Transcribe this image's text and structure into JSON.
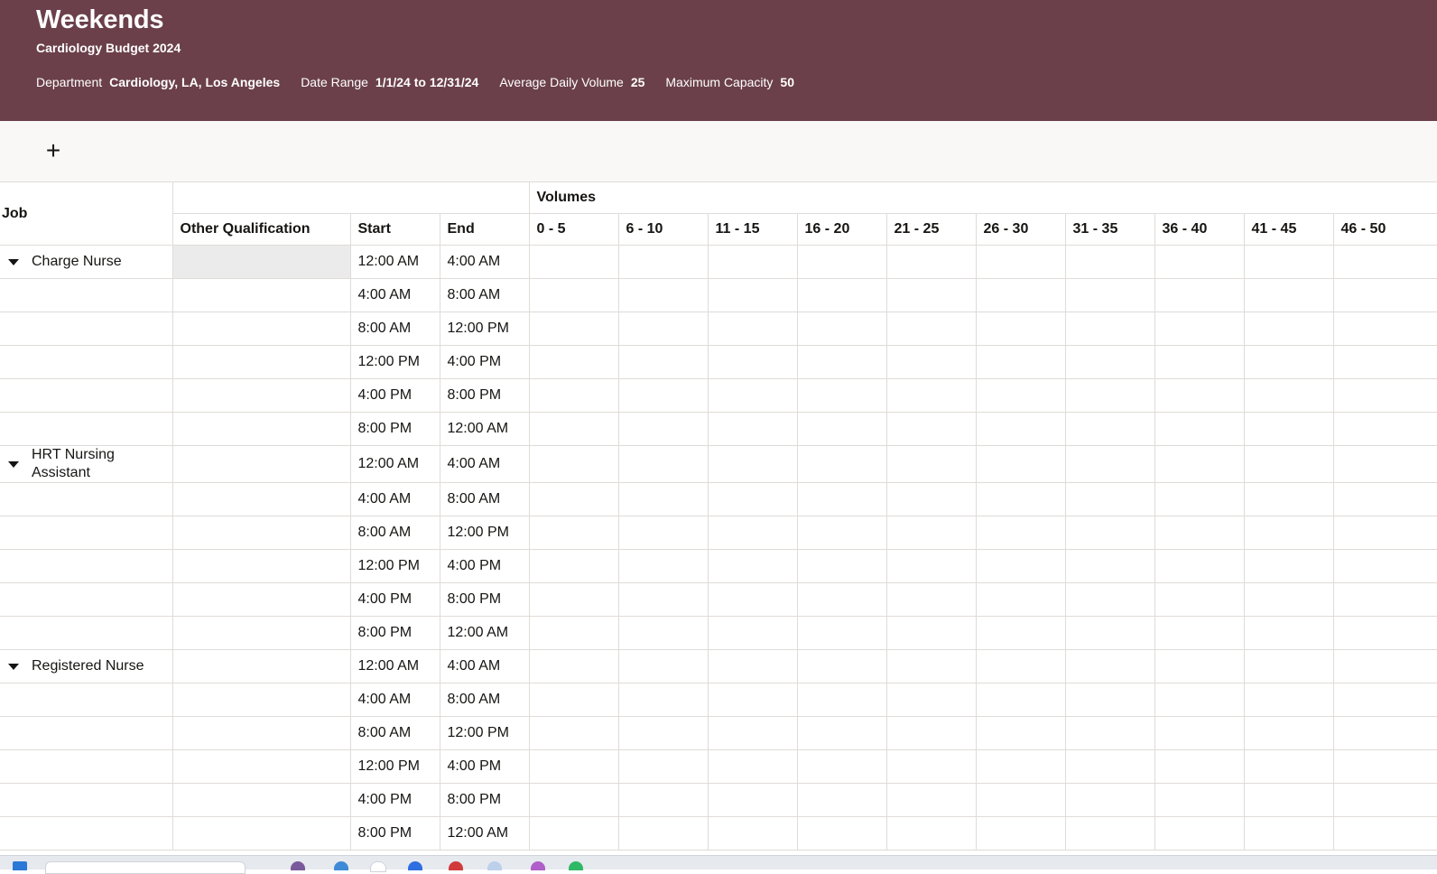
{
  "header": {
    "title": "Weekends",
    "subtitle": "Cardiology Budget 2024",
    "meta": [
      {
        "label": "Department",
        "value": "Cardiology, LA, Los Angeles"
      },
      {
        "label": "Date Range",
        "value": "1/1/24 to 12/31/24"
      },
      {
        "label": "Average Daily Volume",
        "value": "25"
      },
      {
        "label": "Maximum Capacity",
        "value": "50"
      }
    ],
    "background_color": "#6b404a"
  },
  "toolbar": {
    "add_icon": "plus-icon",
    "add_symbol": "+"
  },
  "grid": {
    "job_header": "Job",
    "volumes_header": "Volumes",
    "columns": [
      "Other Qualification",
      "Start",
      "End"
    ],
    "volume_ranges": [
      "0 - 5",
      "6 - 10",
      "11 - 15",
      "16 - 20",
      "21 - 25",
      "26 - 30",
      "31 - 35",
      "36 - 40",
      "41 - 45",
      "46 - 50"
    ],
    "rows": [
      {
        "job": "Charge Nurse",
        "start": "12:00 AM",
        "end": "4:00 AM"
      },
      {
        "job": "",
        "start": "4:00 AM",
        "end": "8:00 AM"
      },
      {
        "job": "",
        "start": "8:00 AM",
        "end": "12:00 PM"
      },
      {
        "job": "",
        "start": "12:00 PM",
        "end": "4:00 PM"
      },
      {
        "job": "",
        "start": "4:00 PM",
        "end": "8:00 PM"
      },
      {
        "job": "",
        "start": "8:00 PM",
        "end": "12:00 AM"
      },
      {
        "job": "HRT Nursing Assistant",
        "start": "12:00 AM",
        "end": "4:00 AM"
      },
      {
        "job": "",
        "start": "4:00 AM",
        "end": "8:00 AM"
      },
      {
        "job": "",
        "start": "8:00 AM",
        "end": "12:00 PM"
      },
      {
        "job": "",
        "start": "12:00 PM",
        "end": "4:00 PM"
      },
      {
        "job": "",
        "start": "4:00 PM",
        "end": "8:00 PM"
      },
      {
        "job": "",
        "start": "8:00 PM",
        "end": "12:00 AM"
      },
      {
        "job": "Registered Nurse",
        "start": "12:00 AM",
        "end": "4:00 AM"
      },
      {
        "job": "",
        "start": "4:00 AM",
        "end": "8:00 AM"
      },
      {
        "job": "",
        "start": "8:00 AM",
        "end": "12:00 PM"
      },
      {
        "job": "",
        "start": "12:00 PM",
        "end": "4:00 PM"
      },
      {
        "job": "",
        "start": "4:00 PM",
        "end": "8:00 PM"
      },
      {
        "job": "",
        "start": "8:00 PM",
        "end": "12:00 AM"
      }
    ]
  }
}
